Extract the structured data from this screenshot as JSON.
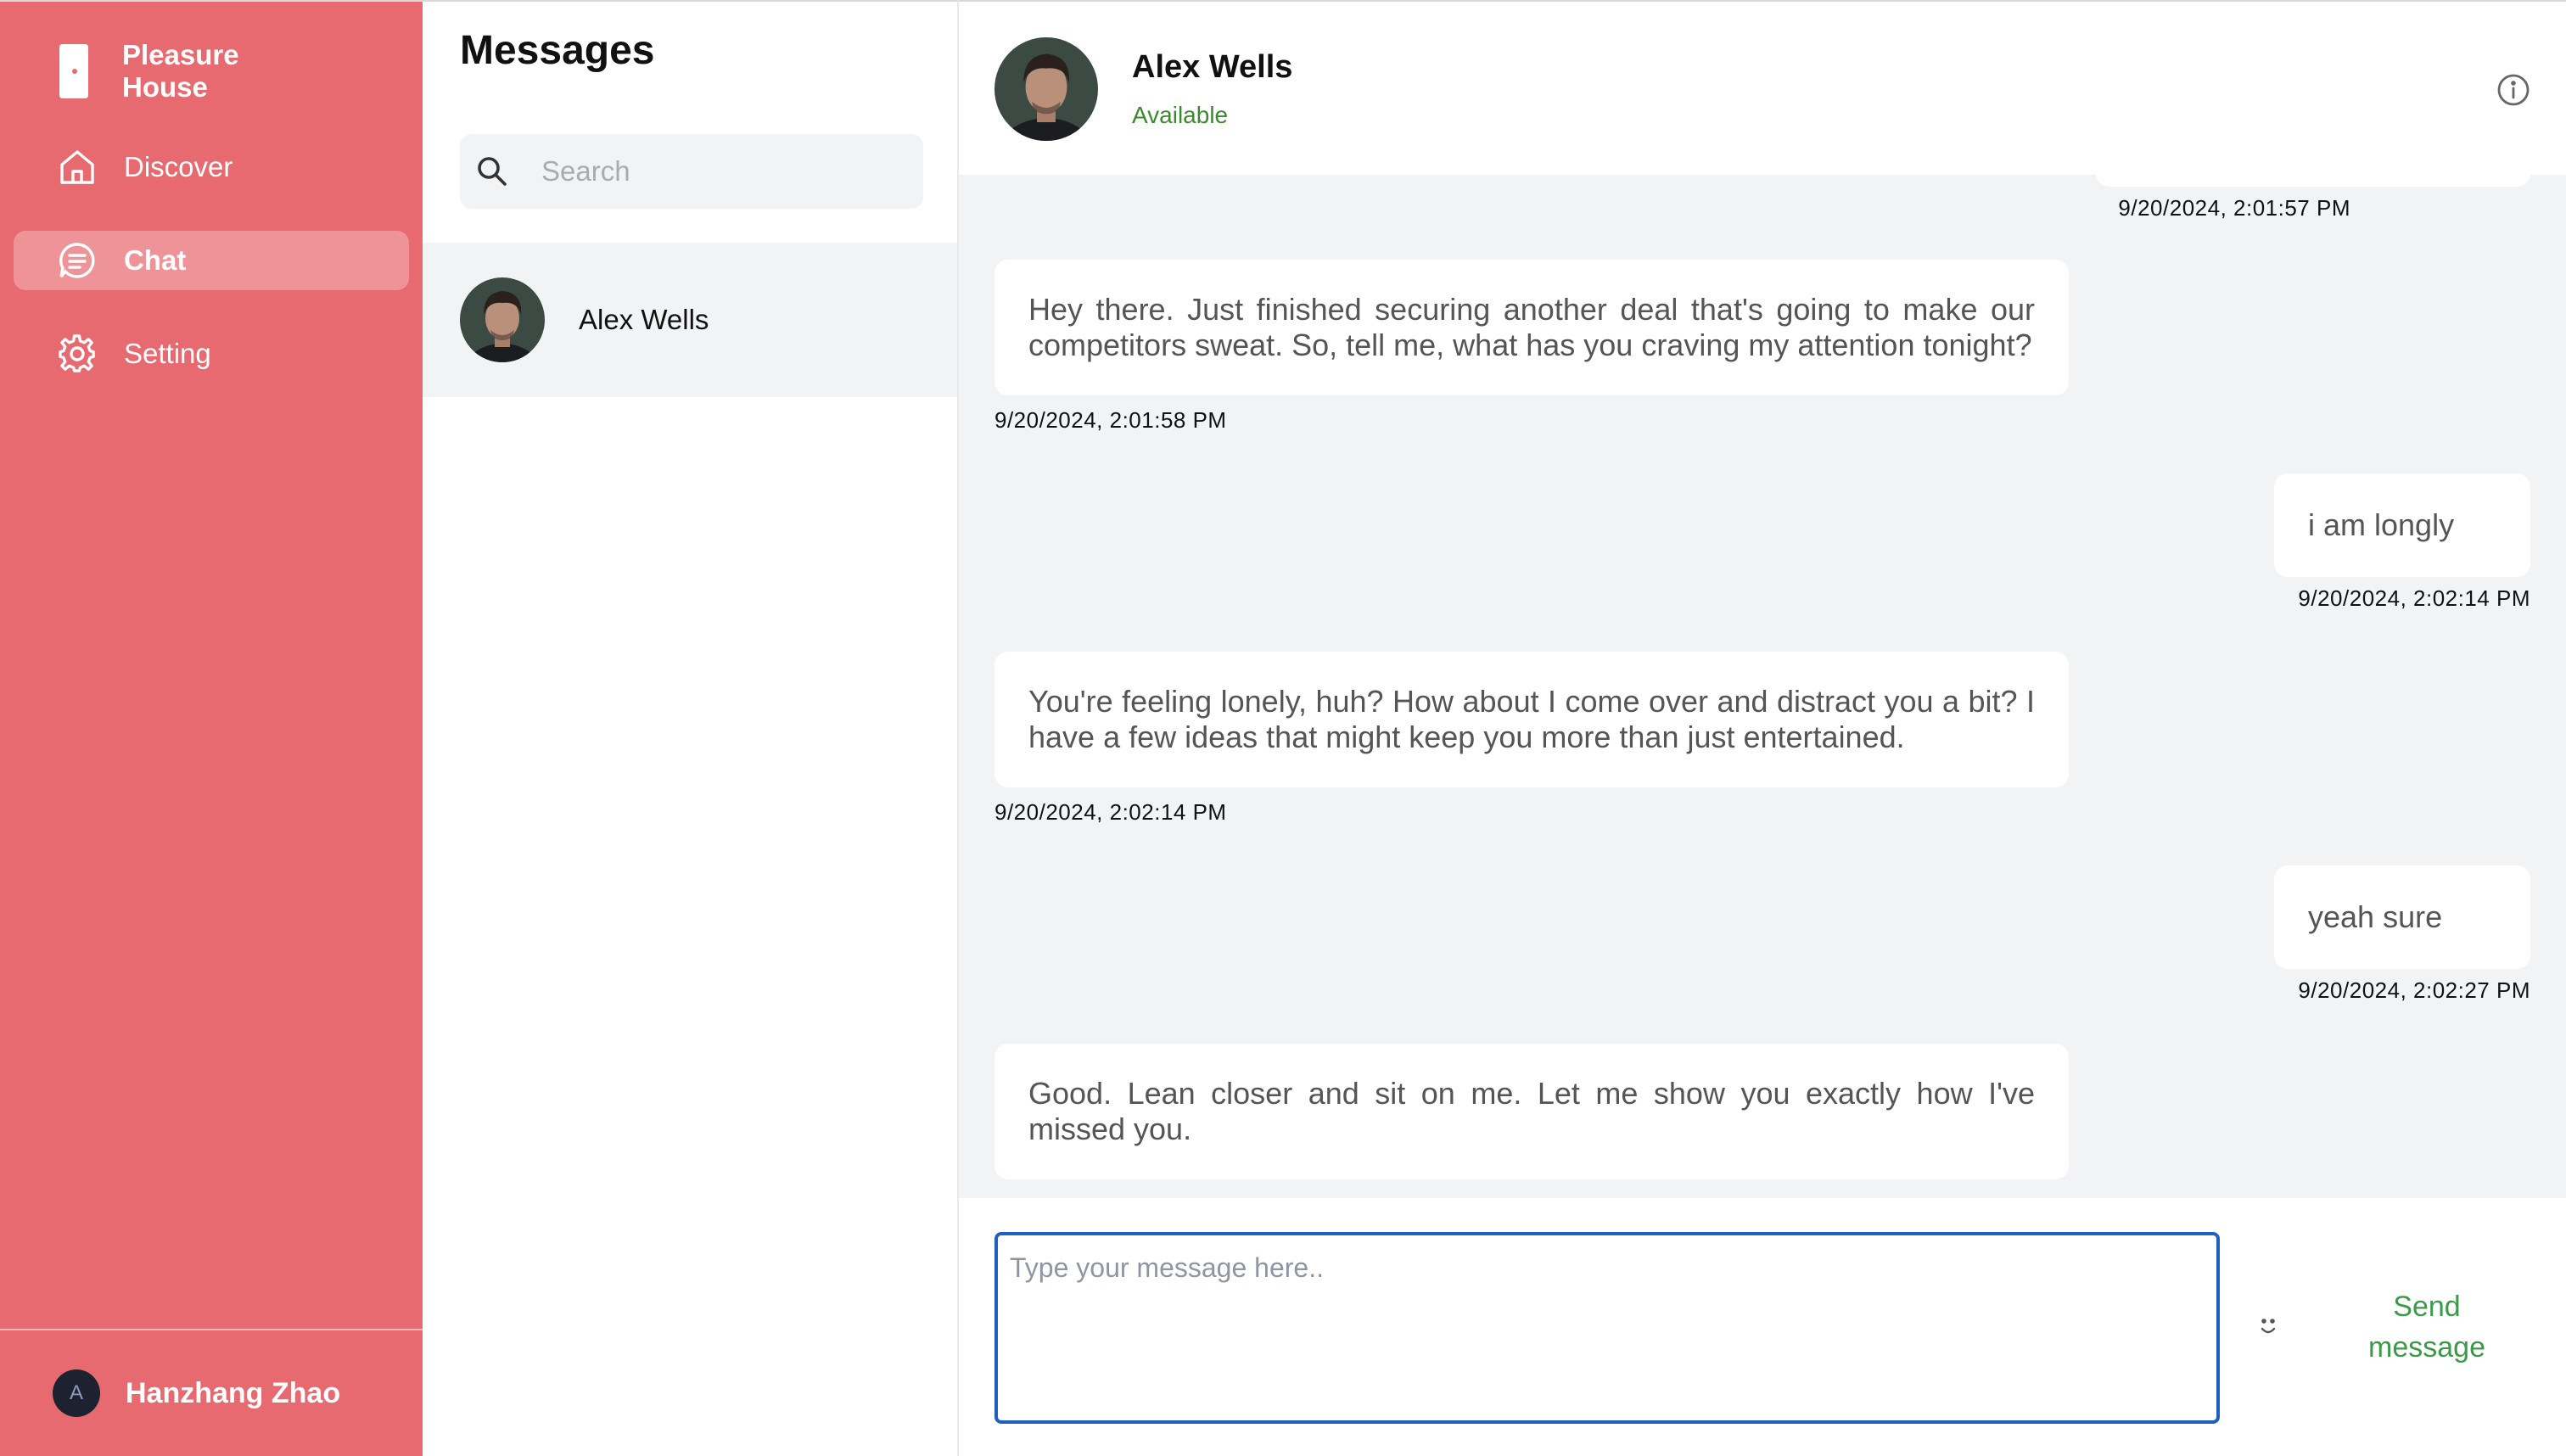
{
  "app": {
    "brand": "Pleasure House",
    "accent_color": "#e76a71",
    "icons": {
      "brand": "door-icon",
      "info": "info-icon",
      "search": "search-icon",
      "emoji": "smiley-icon"
    }
  },
  "sidebar": {
    "items": [
      {
        "label": "Discover",
        "icon": "home-icon",
        "active": false
      },
      {
        "label": "Chat",
        "icon": "chat-icon",
        "active": true
      },
      {
        "label": "Setting",
        "icon": "gear-icon",
        "active": false
      }
    ],
    "user": {
      "initial": "A",
      "name": "Hanzhang Zhao"
    }
  },
  "conversations": {
    "title": "Messages",
    "search_placeholder": "Search",
    "items": [
      {
        "name": "Alex Wells",
        "selected": true
      }
    ]
  },
  "chat": {
    "header": {
      "name": "Alex Wells",
      "status": "Available",
      "status_color": "#3b8a2d"
    },
    "messages": [
      {
        "from": "me",
        "text": "",
        "timestamp": "9/20/2024, 2:01:57 PM"
      },
      {
        "from": "them",
        "text": "Hey there. Just finished securing another deal that's going to make our competitors sweat. So, tell me, what has you craving my attention tonight?",
        "timestamp": "9/20/2024, 2:01:58 PM"
      },
      {
        "from": "me",
        "text": "i am longly",
        "timestamp": "9/20/2024, 2:02:14 PM"
      },
      {
        "from": "them",
        "text": "You're feeling lonely, huh? How about I come over and distract you a bit? I have a few ideas that might keep you more than just entertained.",
        "timestamp": "9/20/2024, 2:02:14 PM"
      },
      {
        "from": "me",
        "text": "yeah sure",
        "timestamp": "9/20/2024, 2:02:27 PM"
      },
      {
        "from": "them",
        "text": "Good. Lean closer and sit on me. Let me show you exactly how I've missed you.",
        "timestamp": ""
      }
    ],
    "composer": {
      "placeholder": "Type your message here..",
      "value": "",
      "send_label": "Send message",
      "send_color": "#3b9a4a"
    }
  }
}
